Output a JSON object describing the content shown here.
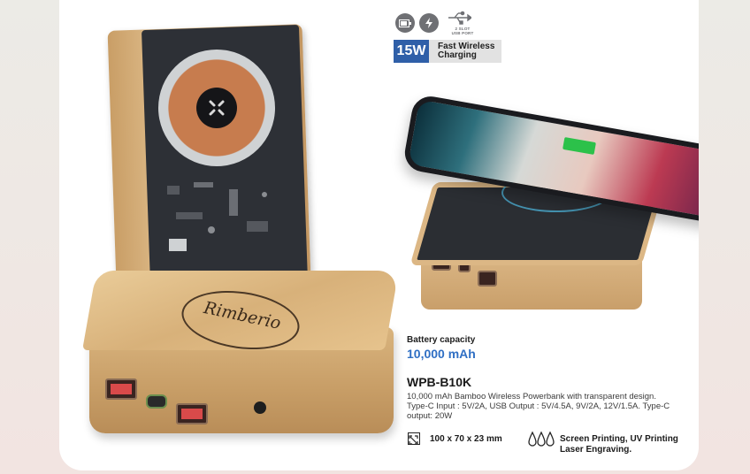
{
  "features": {
    "icons": [
      "battery-icon",
      "fast-charge-icon",
      "usb-icon"
    ],
    "usb_label": "2 SLOT\nUSB PORT",
    "power_badge": "15W",
    "power_badge_text": "Fast Wireless Charging"
  },
  "product": {
    "logo_text": "Rimberio",
    "capacity_label": "Battery capacity",
    "capacity_value": "10,000 mAh",
    "model": "WPB-B10K",
    "description": "10,000 mAh Bamboo Wireless Powerbank with transparent design. Type-C Input : 5V/2A, USB Output : 5V/4.5A, 9V/2A, 12V/1.5A. Type-C output: 20W",
    "dimensions": "100 x 70 x 23 mm",
    "printing": "Screen Printing, UV Printing",
    "printing_line2": "Laser Engraving."
  },
  "colors": {
    "accent_blue": "#2f6fc4",
    "badge_blue": "#2f5fa8",
    "bamboo": "#d8b17a",
    "icon_grey": "#6f7074"
  }
}
